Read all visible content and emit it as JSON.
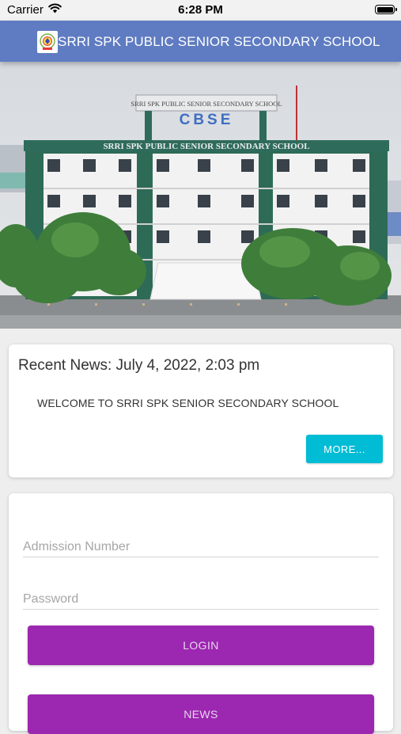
{
  "status_bar": {
    "carrier": "Carrier",
    "time": "6:28 PM",
    "icons": [
      "wifi-icon",
      "battery-icon"
    ]
  },
  "header": {
    "title": "SRRI SPK PUBLIC SENIOR SECONDARY SCHOOL",
    "color": "#5f7cc2",
    "logo_icon": "school-logo"
  },
  "hero": {
    "building_sign_top": "SRRI SPK PUBLIC SENIOR SECONDARY SCHOOL",
    "building_sign_board": "CBSE",
    "building_sign_front": "SRRI SPK PUBLIC SENIOR SECONDARY SCHOOL"
  },
  "news": {
    "heading": "Recent News: July 4, 2022, 2:03 pm",
    "body": "WELCOME TO SRRI SPK SENIOR SECONDARY SCHOOL",
    "more_label": "MORE...",
    "more_color": "#00bcd4"
  },
  "login": {
    "admission_placeholder": "Admission Number",
    "password_placeholder": "Password",
    "login_label": "LOGIN",
    "news_label": "NEWS",
    "button_color": "#9c27b0"
  }
}
